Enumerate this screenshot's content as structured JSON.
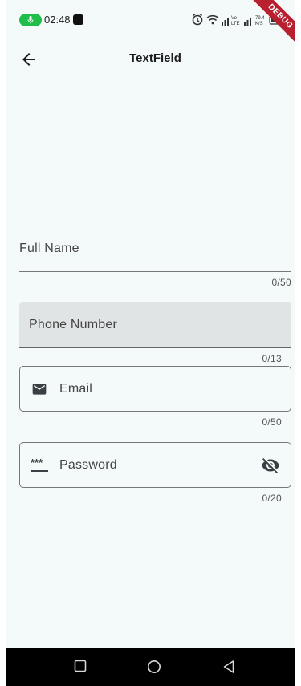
{
  "status_bar": {
    "time": "02:48",
    "debug_label": "DEBUG",
    "icons": [
      "mic-icon",
      "alarm-icon",
      "wifi-icon",
      "signal-icon",
      "volte-icon",
      "signal-icon",
      "network-speed-icon",
      "battery-icon"
    ],
    "colors": {
      "mic_pill": "#1fbe4a",
      "debug_banner": "#b8202f"
    }
  },
  "app_bar": {
    "title": "TextField",
    "back_icon": "arrow-back-icon"
  },
  "fields": [
    {
      "id": "full-name",
      "style": "underline",
      "label": "Full Name",
      "counter": "0/50"
    },
    {
      "id": "phone-number",
      "style": "filled",
      "label": "Phone Number",
      "counter": "0/13"
    },
    {
      "id": "email",
      "style": "outlined",
      "label": "Email",
      "prefix_icon": "mail-icon",
      "counter": "0/50"
    },
    {
      "id": "password",
      "style": "outlined",
      "label": "Password",
      "prefix_icon": "password-dots-icon",
      "suffix_icon": "visibility-off-icon",
      "counter": "0/20"
    }
  ],
  "nav_bar": {
    "buttons": [
      "recents-icon",
      "home-icon",
      "back-triangle-icon"
    ]
  }
}
